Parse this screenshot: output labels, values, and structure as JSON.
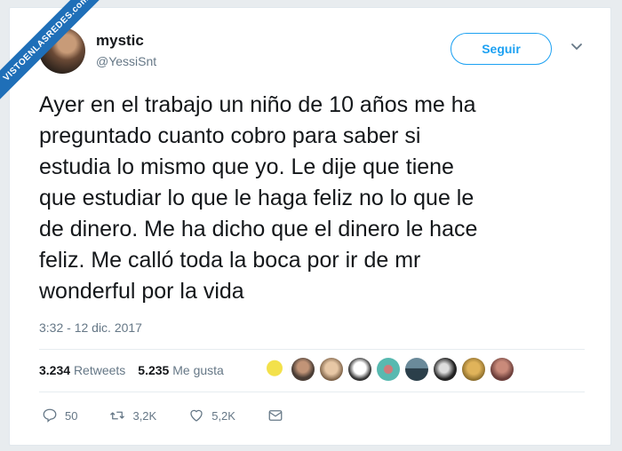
{
  "watermark": "VISTOENLASREDES.com",
  "user": {
    "name": "mystic",
    "handle": "@YessiSnt"
  },
  "follow_label": "Seguir",
  "tweet_text": "Ayer en el trabajo un niño de 10 años me ha\npreguntado cuanto cobro para saber si\nestudia lo mismo que yo. Le dije que tiene\nque estudiar lo que le haga feliz no lo que le\nde dinero. Me ha dicho que el dinero le hace\nfeliz. Me calló toda la boca por ir de mr\nwonderful por la vida",
  "timestamp": "3:32 - 12 dic. 2017",
  "stats": {
    "retweets_count": "3.234",
    "retweets_label": "Retweets",
    "likes_count": "5.235",
    "likes_label": "Me gusta"
  },
  "actions": {
    "reply_count": "50",
    "retweet_count": "3,2K",
    "like_count": "5,2K"
  },
  "colors": {
    "accent": "#1da1f2",
    "text": "#14171a",
    "muted": "#657786"
  },
  "icons": [
    "reply-icon",
    "retweet-icon",
    "heart-icon",
    "mail-icon",
    "chevron-down-icon"
  ]
}
